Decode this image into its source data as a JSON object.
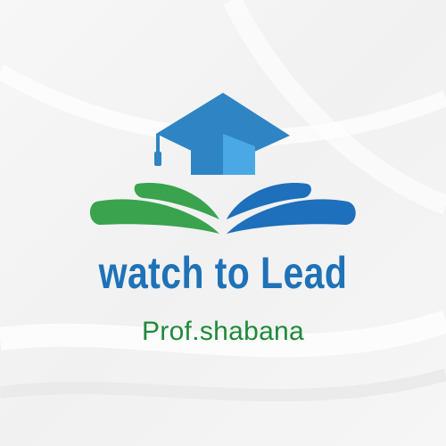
{
  "logo": {
    "brand_name": "watch to Lead",
    "tagline": "Prof.shabana",
    "icons": {
      "cap": "graduation-cap-icon",
      "book": "open-book-icon"
    },
    "colors": {
      "brand_blue": "#1e72b8",
      "cap_blue": "#2f84c4",
      "cap_light_blue": "#4aa8e4",
      "book_green": "#3aa34e",
      "tagline_green": "#1f8a3a",
      "background": "#f4f4f4"
    }
  }
}
